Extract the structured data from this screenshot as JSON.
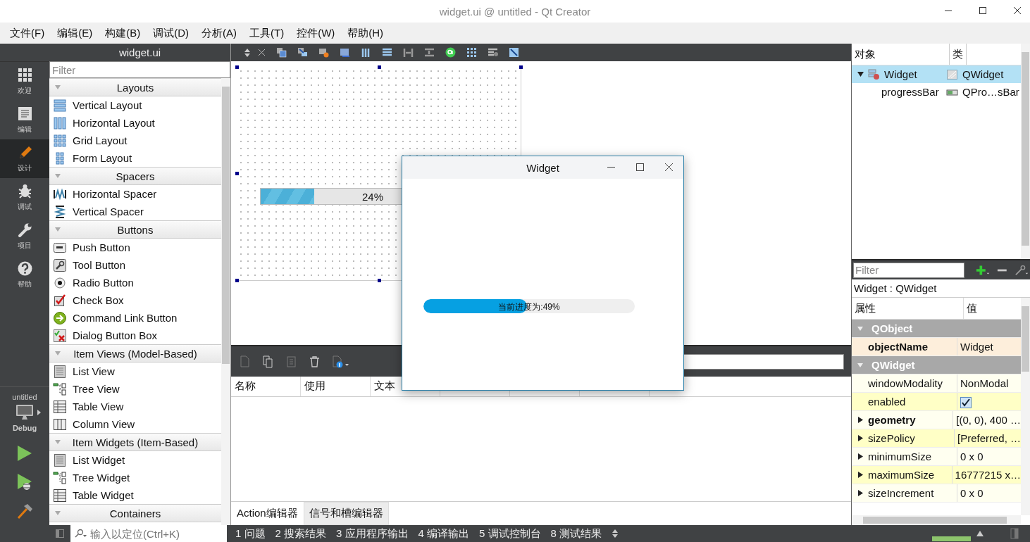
{
  "window": {
    "title": "widget.ui @ untitled - Qt Creator"
  },
  "menu": [
    "文件(F)",
    "编辑(E)",
    "构建(B)",
    "调试(D)",
    "分析(A)",
    "工具(T)",
    "控件(W)",
    "帮助(H)"
  ],
  "modes": [
    {
      "label": "欢迎",
      "selected": false
    },
    {
      "label": "编辑",
      "selected": false
    },
    {
      "label": "设计",
      "selected": true
    },
    {
      "label": "调试",
      "selected": false
    },
    {
      "label": "项目",
      "selected": false
    },
    {
      "label": "帮助",
      "selected": false
    }
  ],
  "kit": {
    "project": "untitled",
    "config": "Debug"
  },
  "widget_box": {
    "title": "widget.ui",
    "filter_placeholder": "Filter",
    "groups": [
      {
        "title": "Layouts",
        "items": [
          "Vertical Layout",
          "Horizontal Layout",
          "Grid Layout",
          "Form Layout"
        ]
      },
      {
        "title": "Spacers",
        "items": [
          "Horizontal Spacer",
          "Vertical Spacer"
        ]
      },
      {
        "title": "Buttons",
        "items": [
          "Push Button",
          "Tool Button",
          "Radio Button",
          "Check Box",
          "Command Link Button",
          "Dialog Button Box"
        ]
      },
      {
        "title": "Item Views (Model-Based)",
        "items": [
          "List View",
          "Tree View",
          "Table View",
          "Column View"
        ]
      },
      {
        "title": "Item Widgets (Item-Based)",
        "items": [
          "List Widget",
          "Tree Widget",
          "Table Widget"
        ]
      },
      {
        "title": "Containers"
      }
    ]
  },
  "form": {
    "progress": {
      "text": "24%",
      "level": 0.24
    }
  },
  "preview_window": {
    "title": "Widget",
    "progress": {
      "text": "当前进度为:49%",
      "level": 0.49
    }
  },
  "action_editor": {
    "columns": [
      "名称",
      "使用",
      "文本"
    ],
    "tabs": [
      {
        "label": "Action编辑器",
        "selected": true
      },
      {
        "label": "信号和槽编辑器",
        "selected": false
      }
    ]
  },
  "object_inspector": {
    "columns": [
      "对象",
      "类"
    ],
    "rows": [
      {
        "object": "Widget",
        "class": "QWidget",
        "selected": true,
        "expanded": true,
        "children": [
          {
            "object": "progressBar",
            "class": "QPro…sBar",
            "selected": false
          }
        ]
      }
    ]
  },
  "property_editor": {
    "filter_placeholder": "Filter",
    "caption": "Widget : QWidget",
    "columns": [
      "属性",
      "值"
    ],
    "rows": [
      {
        "kind": "group",
        "name": "QObject"
      },
      {
        "kind": "text",
        "name": "objectName",
        "value": "Widget",
        "bold": true,
        "expandable": false
      },
      {
        "kind": "group",
        "name": "QWidget"
      },
      {
        "kind": "text",
        "name": "windowModality",
        "value": "NonModal",
        "bold": false,
        "expandable": false
      },
      {
        "kind": "check",
        "name": "enabled",
        "checked": true
      },
      {
        "kind": "text",
        "name": "geometry",
        "value": "[(0, 0), 400 …",
        "bold": true,
        "expandable": true
      },
      {
        "kind": "text",
        "name": "sizePolicy",
        "value": "[Preferred, …",
        "bold": false,
        "expandable": true
      },
      {
        "kind": "text",
        "name": "minimumSize",
        "value": "0 x 0",
        "bold": false,
        "expandable": true
      },
      {
        "kind": "text",
        "name": "maximumSize",
        "value": "16777215 x…",
        "bold": false,
        "expandable": true
      },
      {
        "kind": "text",
        "name": "sizeIncrement",
        "value": "0 x 0",
        "bold": false,
        "expandable": true
      }
    ]
  },
  "status_bar": {
    "locator_placeholder": "输入以定位(Ctrl+K)",
    "panes": [
      "1 问题",
      "2 搜索结果",
      "3 应用程序输出",
      "4 编译输出",
      "5 调试控制台",
      "8 测试结果"
    ],
    "build_progress": {
      "level": 1
    }
  }
}
